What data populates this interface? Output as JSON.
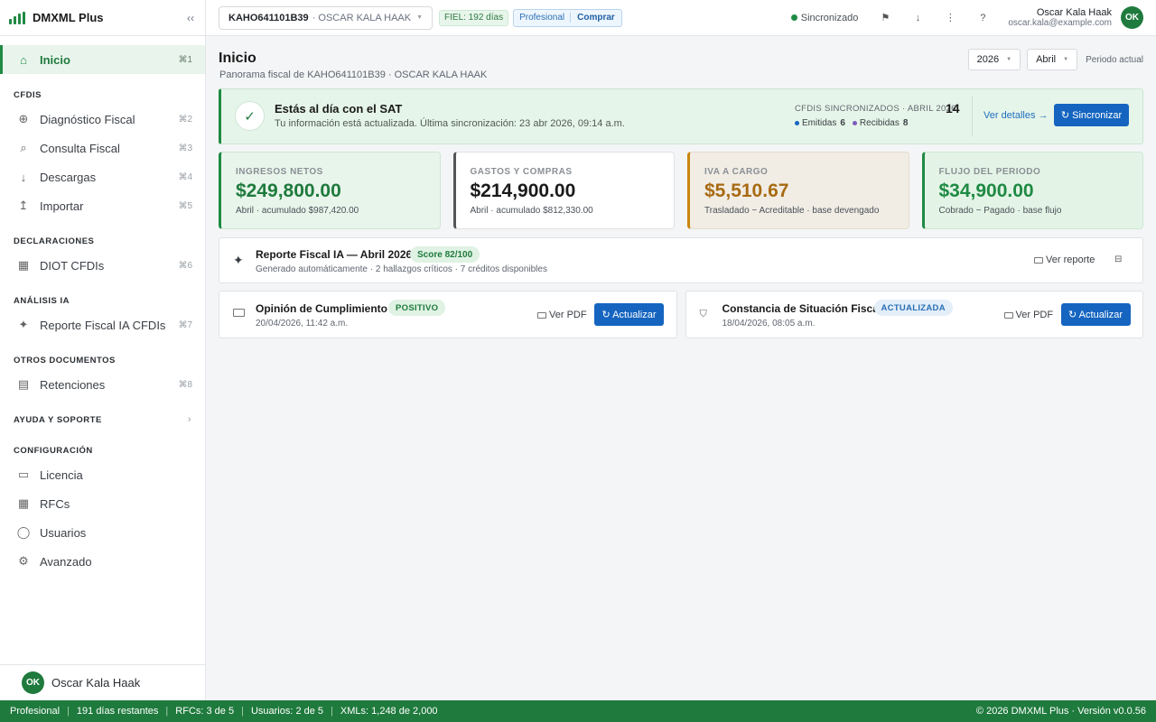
{
  "app": {
    "name": "DMXML Plus",
    "collapse_icon": "‹‹"
  },
  "colors": {
    "brand_green": "#1f8a43",
    "primary_blue": "#1565c0",
    "ingresos": "#1f7a3d",
    "gastos": "#1a1a1a",
    "iva": "#a86a12",
    "flujo": "#1f8a43"
  },
  "sidebar": {
    "active": {
      "label": "Inicio",
      "kbd": "⌘1",
      "icon": "home-icon"
    },
    "sections": [
      {
        "title": "CFDIS",
        "items": [
          {
            "label": "Diagnóstico Fiscal",
            "kbd": "⌘2",
            "icon": "⊕",
            "icon_name": "diagnostic-icon"
          },
          {
            "label": "Consulta Fiscal",
            "kbd": "⌘3",
            "icon": "⌕",
            "icon_name": "search-icon"
          },
          {
            "label": "Descargas",
            "kbd": "⌘4",
            "icon": "↓",
            "icon_name": "download-icon"
          },
          {
            "label": "Importar",
            "kbd": "⌘5",
            "icon": "↥",
            "icon_name": "import-icon"
          }
        ]
      },
      {
        "title": "DECLARACIONES",
        "items": [
          {
            "label": "DIOT CFDIs",
            "kbd": "⌘6",
            "icon": "▦",
            "icon_name": "grid-icon"
          }
        ]
      },
      {
        "title": "ANÁLISIS IA",
        "items": [
          {
            "label": "Reporte Fiscal IA CFDIs",
            "kbd": "⌘7",
            "icon": "✦",
            "icon_name": "sparkle-icon"
          }
        ]
      },
      {
        "title": "OTROS DOCUMENTOS",
        "items": [
          {
            "label": "Retenciones",
            "kbd": "⌘8",
            "icon": "▤",
            "icon_name": "document-icon"
          }
        ]
      }
    ],
    "help_section": "AYUDA Y SOPORTE",
    "config_section": "CONFIGURACIÓN",
    "config_items": [
      {
        "label": "Licencia",
        "icon": "▭",
        "icon_name": "license-icon"
      },
      {
        "label": "RFCs",
        "icon": "▦",
        "icon_name": "rfc-grid-icon"
      },
      {
        "label": "Usuarios",
        "icon": "◯",
        "icon_name": "users-icon"
      },
      {
        "label": "Avanzado",
        "icon": "⚙",
        "icon_name": "gear-icon"
      }
    ],
    "user": {
      "initials": "OK",
      "name": "Oscar Kala Haak"
    }
  },
  "topbar": {
    "rfc": "KAHO641101B39",
    "rfc_name": "· OSCAR KALA HAAK",
    "fiel": "FIEL: 192 días",
    "plan": "Profesional",
    "buy": "Comprar",
    "sync": "Sincronizado",
    "user_name": "Oscar Kala Haak",
    "user_email": "oscar.kala@example.com",
    "user_initials": "OK"
  },
  "page": {
    "title": "Inicio",
    "subtitle": "Panorama fiscal de KAHO641101B39 · OSCAR KALA HAAK",
    "year": "2026",
    "month": "Abril",
    "period_text": "Periodo actual"
  },
  "status": {
    "title": "Estás al día con el SAT",
    "subtitle": "Tu información está actualizada. Última sincronización: 23 abr 2026, 09:14 a.m.",
    "cfdis_label": "CFDIS SINCRONIZADOS · ABRIL 2026",
    "cfdis_count": "14",
    "emitidas_label": "Emitidas",
    "emitidas": "6",
    "recibidas_label": "Recibidas",
    "recibidas": "8",
    "details": "Ver detalles →",
    "sync_button": "↻ Sincronizar"
  },
  "kpis": [
    {
      "label": "INGRESOS NETOS",
      "value": "$249,800.00",
      "sub": "Abril · acumulado $987,420.00"
    },
    {
      "label": "GASTOS Y COMPRAS",
      "value": "$214,900.00",
      "sub": "Abril · acumulado $812,330.00"
    },
    {
      "label": "IVA A CARGO",
      "value": "$5,510.67",
      "sub": "Trasladado − Acreditable · base devengado"
    },
    {
      "label": "FLUJO DEL PERIODO",
      "value": "$34,900.00",
      "sub": "Cobrado − Pagado · base flujo"
    }
  ],
  "ai_report": {
    "title": "Reporte Fiscal IA — Abril 2026",
    "score": "Score 82/100",
    "subtitle": "Generado automáticamente · 2 hallazgos críticos · 7 créditos disponibles",
    "view": "Ver reporte"
  },
  "docs": [
    {
      "title": "Opinión de Cumplimiento",
      "badge": "POSITIVO",
      "date": "20/04/2026, 11:42 a.m.",
      "pdf": "Ver PDF",
      "button": "↻ Actualizar"
    },
    {
      "title": "Constancia de Situación Fiscal",
      "badge": "ACTUALIZADA",
      "date": "18/04/2026, 08:05 a.m.",
      "pdf": "Ver PDF",
      "button": "↻ Actualizar"
    }
  ],
  "footer": {
    "plan": "Profesional",
    "days": "191 días restantes",
    "rfcs": "RFCs: 3 de 5",
    "users": "Usuarios: 2 de 5",
    "xmls": "XMLs: 1,248 de 2,000",
    "copyright": "© 2026 DMXML Plus · Versión v0.0.56"
  }
}
